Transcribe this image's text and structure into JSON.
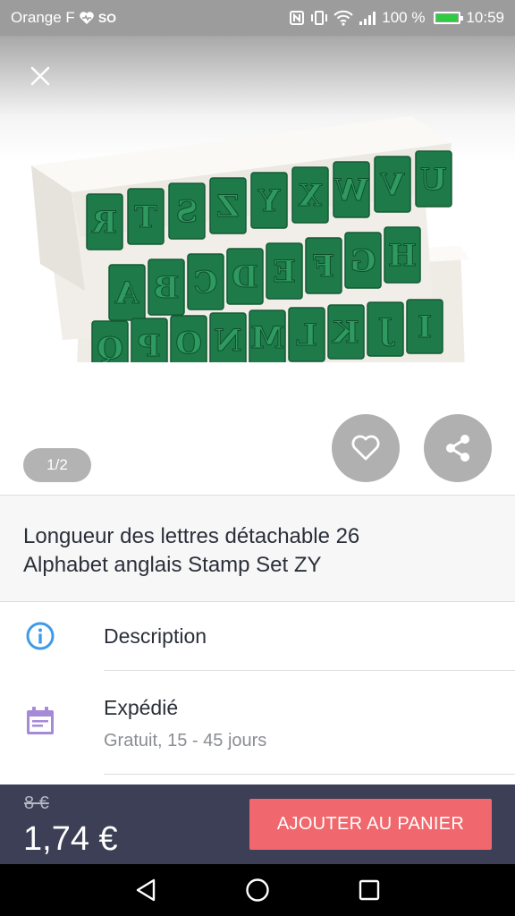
{
  "status_bar": {
    "carrier": "Orange F",
    "extra": "SO",
    "battery": "100 %",
    "battery_level": 1.0,
    "time": "10:59"
  },
  "hero": {
    "pager": "1/2",
    "stamp_rows": [
      [
        "U",
        "V",
        "W",
        "X",
        "Y",
        "Z",
        "S",
        "T",
        "R"
      ],
      [
        "H",
        "G",
        "F",
        "E",
        "D",
        "C",
        "B",
        "A"
      ],
      [
        "I",
        "J",
        "K",
        "L",
        "M",
        "N",
        "O",
        "P",
        "Q"
      ]
    ]
  },
  "product": {
    "title_line1": "Longueur des lettres détachable 26",
    "title_line2": "Alphabet anglais Stamp Set ZY"
  },
  "info": {
    "description_label": "Description",
    "shipping_label": "Expédié",
    "shipping_detail": "Gratuit, 15 - 45 jours"
  },
  "purchase": {
    "old_price": "8 €",
    "price": "1,74 €",
    "cart_button": "AJOUTER AU PANIER"
  },
  "colors": {
    "accent": "#f0686d",
    "bar": "#3c3f55",
    "info_icon": "#3d9be9",
    "calendar_icon": "#a58ad8"
  }
}
